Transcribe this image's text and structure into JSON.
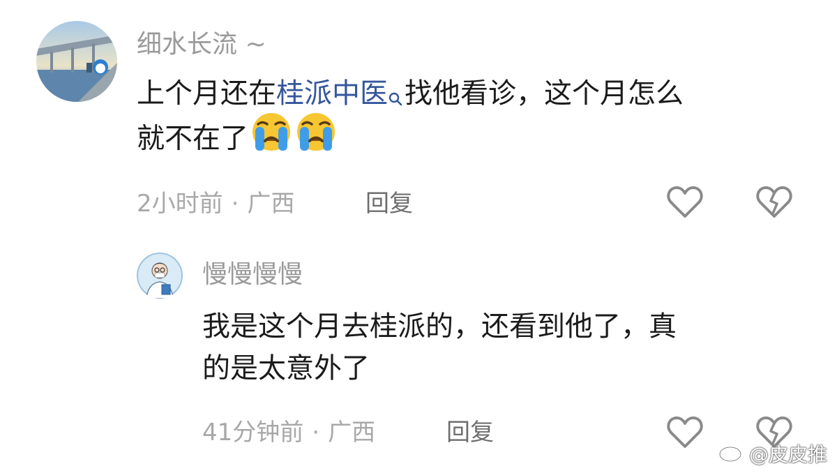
{
  "comments": [
    {
      "username": "细水长流 ~",
      "content_lines": [
        {
          "before": "上个月还在",
          "link": "桂派中医",
          "after": "找他看诊，这个月怎么"
        },
        {
          "text": "就不在了"
        }
      ],
      "emojis": [
        "crying-face-icon",
        "crying-face-icon"
      ],
      "time": "2小时前",
      "separator": "·",
      "location": "广西",
      "reply_label": "回复"
    },
    {
      "username": "慢慢慢慢",
      "content_lines": [
        {
          "text": "我是这个月去桂派的，还看到他了，真"
        },
        {
          "text": "的是太意外了"
        }
      ],
      "time": "41分钟前",
      "separator": "·",
      "location": "广西",
      "reply_label": "回复"
    }
  ],
  "watermark": "@皮皮推",
  "colors": {
    "link": "#34569c",
    "username": "#9a9a9a",
    "meta": "#a8a8a8",
    "text": "#1b1b1b",
    "icon": "#8a8a8a"
  }
}
